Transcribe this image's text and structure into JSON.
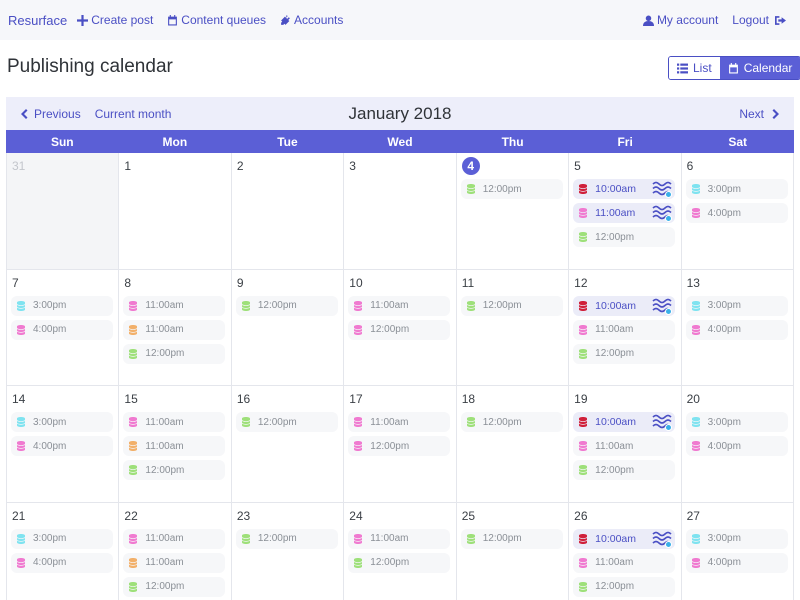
{
  "navbar": {
    "brand": "Resurface",
    "create_post": "Create post",
    "content_queues": "Content queues",
    "accounts": "Accounts",
    "my_account": "My account",
    "logout": "Logout"
  },
  "page": {
    "title": "Publishing calendar",
    "view_list": "List",
    "view_calendar": "Calendar"
  },
  "toolbar": {
    "previous": "Previous",
    "current_month": "Current month",
    "month_title": "January 2018",
    "next": "Next"
  },
  "weekdays": [
    "Sun",
    "Mon",
    "Tue",
    "Wed",
    "Thu",
    "Fri",
    "Sat"
  ],
  "colors": {
    "accent": "#5b5fd6",
    "cyan": "#7fe3f0",
    "pink": "#f07ad0",
    "orange": "#f2b06a",
    "green": "#9ee07a",
    "red": "#d0203a"
  },
  "weeks": [
    [
      {
        "date": "31",
        "other": true,
        "slots": []
      },
      {
        "date": "1",
        "slots": []
      },
      {
        "date": "2",
        "slots": []
      },
      {
        "date": "3",
        "slots": []
      },
      {
        "date": "4",
        "today": true,
        "slots": [
          {
            "time": "12:00pm",
            "color": "green"
          }
        ]
      },
      {
        "date": "5",
        "slots": [
          {
            "time": "10:00am",
            "color": "red",
            "filled": true
          },
          {
            "time": "11:00am",
            "color": "pink",
            "filled": true
          },
          {
            "time": "12:00pm",
            "color": "green"
          }
        ]
      },
      {
        "date": "6",
        "slots": [
          {
            "time": "3:00pm",
            "color": "cyan"
          },
          {
            "time": "4:00pm",
            "color": "pink"
          }
        ]
      }
    ],
    [
      {
        "date": "7",
        "slots": [
          {
            "time": "3:00pm",
            "color": "cyan"
          },
          {
            "time": "4:00pm",
            "color": "pink"
          }
        ]
      },
      {
        "date": "8",
        "slots": [
          {
            "time": "11:00am",
            "color": "pink"
          },
          {
            "time": "11:00am",
            "color": "orange"
          },
          {
            "time": "12:00pm",
            "color": "green"
          }
        ]
      },
      {
        "date": "9",
        "slots": [
          {
            "time": "12:00pm",
            "color": "green"
          }
        ]
      },
      {
        "date": "10",
        "slots": [
          {
            "time": "11:00am",
            "color": "pink"
          },
          {
            "time": "12:00pm",
            "color": "pink"
          }
        ]
      },
      {
        "date": "11",
        "slots": [
          {
            "time": "12:00pm",
            "color": "green"
          }
        ]
      },
      {
        "date": "12",
        "slots": [
          {
            "time": "10:00am",
            "color": "red",
            "filled": true
          },
          {
            "time": "11:00am",
            "color": "pink"
          },
          {
            "time": "12:00pm",
            "color": "green"
          }
        ]
      },
      {
        "date": "13",
        "slots": [
          {
            "time": "3:00pm",
            "color": "cyan"
          },
          {
            "time": "4:00pm",
            "color": "pink"
          }
        ]
      }
    ],
    [
      {
        "date": "14",
        "slots": [
          {
            "time": "3:00pm",
            "color": "cyan"
          },
          {
            "time": "4:00pm",
            "color": "pink"
          }
        ]
      },
      {
        "date": "15",
        "slots": [
          {
            "time": "11:00am",
            "color": "pink"
          },
          {
            "time": "11:00am",
            "color": "orange"
          },
          {
            "time": "12:00pm",
            "color": "green"
          }
        ]
      },
      {
        "date": "16",
        "slots": [
          {
            "time": "12:00pm",
            "color": "green"
          }
        ]
      },
      {
        "date": "17",
        "slots": [
          {
            "time": "11:00am",
            "color": "pink"
          },
          {
            "time": "12:00pm",
            "color": "pink"
          }
        ]
      },
      {
        "date": "18",
        "slots": [
          {
            "time": "12:00pm",
            "color": "green"
          }
        ]
      },
      {
        "date": "19",
        "slots": [
          {
            "time": "10:00am",
            "color": "red",
            "filled": true
          },
          {
            "time": "11:00am",
            "color": "pink"
          },
          {
            "time": "12:00pm",
            "color": "green"
          }
        ]
      },
      {
        "date": "20",
        "slots": [
          {
            "time": "3:00pm",
            "color": "cyan"
          },
          {
            "time": "4:00pm",
            "color": "pink"
          }
        ]
      }
    ],
    [
      {
        "date": "21",
        "slots": [
          {
            "time": "3:00pm",
            "color": "cyan"
          },
          {
            "time": "4:00pm",
            "color": "pink"
          }
        ]
      },
      {
        "date": "22",
        "slots": [
          {
            "time": "11:00am",
            "color": "pink"
          },
          {
            "time": "11:00am",
            "color": "orange"
          },
          {
            "time": "12:00pm",
            "color": "green"
          }
        ]
      },
      {
        "date": "23",
        "slots": [
          {
            "time": "12:00pm",
            "color": "green"
          }
        ]
      },
      {
        "date": "24",
        "slots": [
          {
            "time": "11:00am",
            "color": "pink"
          },
          {
            "time": "12:00pm",
            "color": "green"
          }
        ]
      },
      {
        "date": "25",
        "slots": [
          {
            "time": "12:00pm",
            "color": "green"
          }
        ]
      },
      {
        "date": "26",
        "slots": [
          {
            "time": "10:00am",
            "color": "red",
            "filled": true
          },
          {
            "time": "11:00am",
            "color": "pink"
          },
          {
            "time": "12:00pm",
            "color": "green"
          }
        ]
      },
      {
        "date": "27",
        "slots": [
          {
            "time": "3:00pm",
            "color": "cyan"
          },
          {
            "time": "4:00pm",
            "color": "pink"
          }
        ]
      }
    ]
  ]
}
